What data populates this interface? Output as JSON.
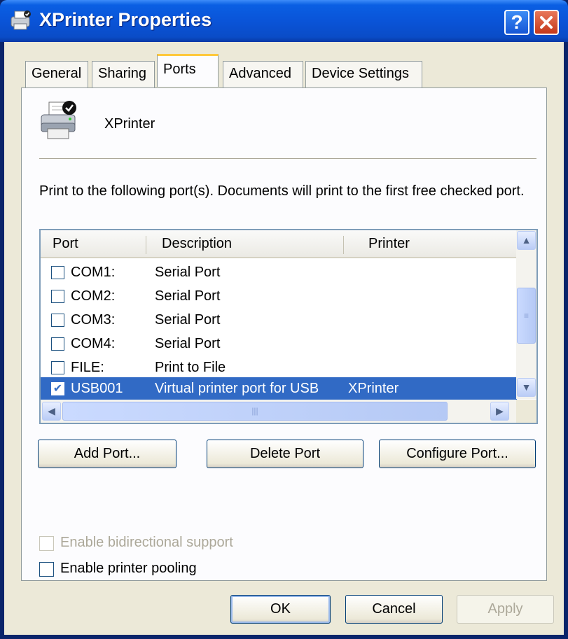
{
  "window": {
    "title": "XPrinter Properties",
    "help_label": "?",
    "close_label": "✕"
  },
  "tabs": [
    {
      "label": "General",
      "active": false
    },
    {
      "label": "Sharing",
      "active": false
    },
    {
      "label": "Ports",
      "active": true
    },
    {
      "label": "Advanced",
      "active": false
    },
    {
      "label": "Device Settings",
      "active": false
    }
  ],
  "printer": {
    "name": "XPrinter"
  },
  "instructions": "Print to the following port(s). Documents will print to the first free checked port.",
  "ports_table": {
    "columns": [
      "Port",
      "Description",
      "Printer"
    ],
    "rows": [
      {
        "port": "COM1:",
        "description": "Serial Port",
        "printer": "",
        "checked": false,
        "selected": false
      },
      {
        "port": "COM2:",
        "description": "Serial Port",
        "printer": "",
        "checked": false,
        "selected": false
      },
      {
        "port": "COM3:",
        "description": "Serial Port",
        "printer": "",
        "checked": false,
        "selected": false
      },
      {
        "port": "COM4:",
        "description": "Serial Port",
        "printer": "",
        "checked": false,
        "selected": false
      },
      {
        "port": "FILE:",
        "description": "Print to File",
        "printer": "",
        "checked": false,
        "selected": false
      },
      {
        "port": "USB001",
        "description": "Virtual printer port for USB",
        "printer": "XPrinter",
        "checked": true,
        "selected": true
      }
    ]
  },
  "port_buttons": {
    "add": "Add Port...",
    "delete": "Delete Port",
    "configure": "Configure Port..."
  },
  "options": {
    "bidirectional": {
      "label": "Enable bidirectional support",
      "checked": false,
      "enabled": false
    },
    "pooling": {
      "label": "Enable printer pooling",
      "checked": false,
      "enabled": true
    }
  },
  "dialog_buttons": {
    "ok": "OK",
    "cancel": "Cancel",
    "apply": "Apply"
  },
  "colors": {
    "title_bar": "#0a54d8",
    "selection": "#316ac5",
    "dialog_bg": "#ece9d8",
    "active_tab_accent": "#ffc83c"
  }
}
